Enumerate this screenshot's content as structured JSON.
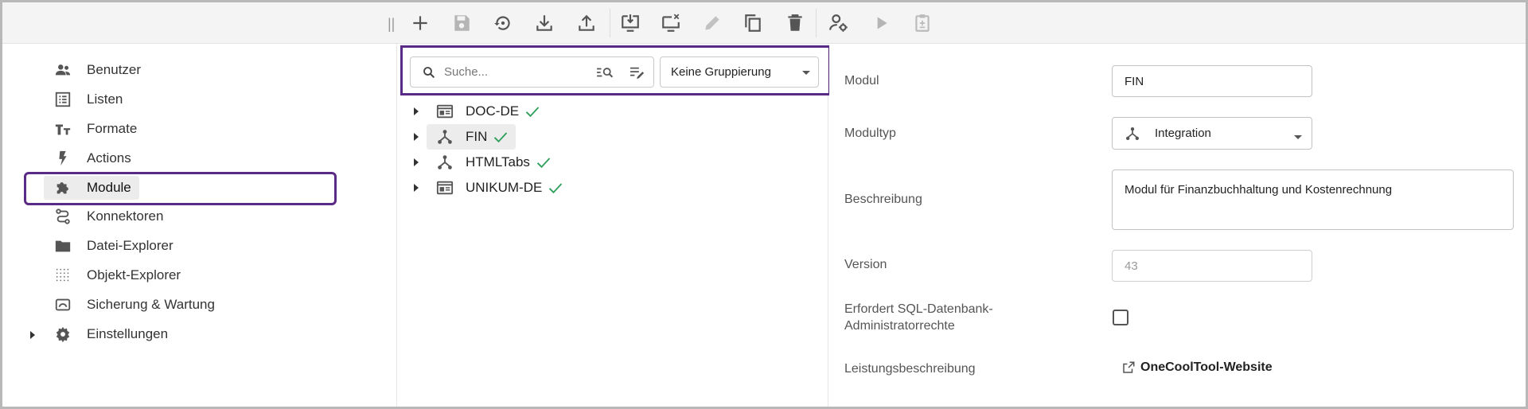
{
  "toolbar": {
    "grip": "||",
    "buttons": [
      {
        "name": "add",
        "icon": "plus-icon",
        "enabled": true
      },
      {
        "name": "save",
        "icon": "save-icon",
        "enabled": false
      },
      {
        "name": "revert",
        "icon": "history-icon",
        "enabled": true
      },
      {
        "name": "import",
        "icon": "download-icon",
        "enabled": true
      },
      {
        "name": "export",
        "icon": "upload-icon",
        "enabled": true
      },
      {
        "name": "deploy",
        "icon": "monitor-download-icon",
        "enabled": true
      },
      {
        "name": "undeploy",
        "icon": "monitor-remove-icon",
        "enabled": true
      },
      {
        "name": "edit",
        "icon": "pencil-icon",
        "enabled": false
      },
      {
        "name": "copy",
        "icon": "copy-icon",
        "enabled": true
      },
      {
        "name": "delete",
        "icon": "trash-icon",
        "enabled": true
      },
      {
        "name": "user-settings",
        "icon": "user-cog-icon",
        "enabled": true
      },
      {
        "name": "run",
        "icon": "play-icon",
        "enabled": false
      },
      {
        "name": "clipboard",
        "icon": "clipboard-icon",
        "enabled": false
      }
    ]
  },
  "nav": {
    "items": [
      {
        "label": "Benutzer",
        "icon": "users-icon"
      },
      {
        "label": "Listen",
        "icon": "list-icon"
      },
      {
        "label": "Formate",
        "icon": "text-format-icon"
      },
      {
        "label": "Actions",
        "icon": "lightning-icon"
      },
      {
        "label": "Module",
        "icon": "puzzle-icon",
        "active": true
      },
      {
        "label": "Konnektoren",
        "icon": "connector-icon"
      },
      {
        "label": "Datei-Explorer",
        "icon": "folder-icon"
      },
      {
        "label": "Objekt-Explorer",
        "icon": "dots-grid-icon"
      },
      {
        "label": "Sicherung & Wartung",
        "icon": "backup-icon"
      },
      {
        "label": "Einstellungen",
        "icon": "gear-icon",
        "expandable": true
      }
    ]
  },
  "search": {
    "placeholder": "Suche...",
    "grouping": "Keine Gruppierung"
  },
  "tree": {
    "items": [
      {
        "label": "DOC-DE",
        "icon": "window-icon",
        "status": "ok"
      },
      {
        "label": "FIN",
        "icon": "integration-icon",
        "status": "ok",
        "selected": true
      },
      {
        "label": "HTMLTabs",
        "icon": "integration-icon",
        "status": "ok"
      },
      {
        "label": "UNIKUM-DE",
        "icon": "window-icon",
        "status": "ok"
      }
    ]
  },
  "form": {
    "modul_label": "Modul",
    "modul_value": "FIN",
    "modultyp_label": "Modultyp",
    "modultyp_value": "Integration",
    "beschreibung_label": "Beschreibung",
    "beschreibung_value": "Modul für Finanzbuchhaltung und Kostenrechnung",
    "version_label": "Version",
    "version_value": "43",
    "sql_label_line1": "Erfordert SQL-Datenbank-",
    "sql_label_line2": "Administratorrechte",
    "sql_checked": false,
    "leistung_label": "Leistungsbeschreibung",
    "leistung_link": "OneCoolTool-Website"
  },
  "colors": {
    "highlight": "#5b2a86",
    "check": "#2e9e5b",
    "icon": "#555555",
    "icon_disabled": "#b5b5b5"
  }
}
